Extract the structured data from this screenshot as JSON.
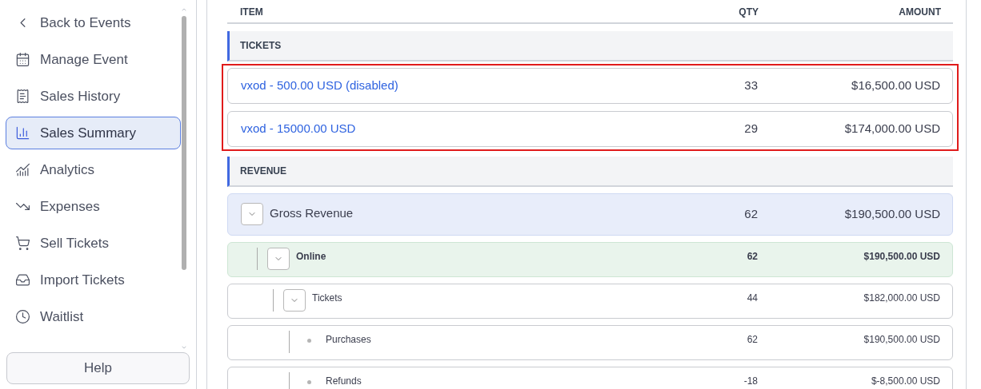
{
  "sidebar": {
    "items": [
      {
        "label": "Back to Events",
        "selected": false
      },
      {
        "label": "Manage Event",
        "selected": false
      },
      {
        "label": "Sales History",
        "selected": false
      },
      {
        "label": "Sales Summary",
        "selected": true
      },
      {
        "label": "Analytics",
        "selected": false
      },
      {
        "label": "Expenses",
        "selected": false
      },
      {
        "label": "Sell Tickets",
        "selected": false
      },
      {
        "label": "Import Tickets",
        "selected": false
      },
      {
        "label": "Waitlist",
        "selected": false
      }
    ],
    "help_button": "Help"
  },
  "table": {
    "columns": [
      "ITEM",
      "QTY",
      "AMOUNT"
    ],
    "sections": [
      {
        "kind": "tickets",
        "title": "TICKETS",
        "highlighted": true,
        "rows": [
          {
            "item": "vxod - 500.00 USD (disabled)",
            "qty": "33",
            "amount": "$16,500.00 USD"
          },
          {
            "item": "vxod - 15000.00 USD",
            "qty": "29",
            "amount": "$174,000.00 USD"
          }
        ]
      },
      {
        "kind": "tree",
        "title": "REVENUE",
        "highlighted": false,
        "rows": [
          {
            "item": "Gross Revenue",
            "qty": "62",
            "amount": "$190,500.00 USD",
            "expanded": true,
            "children": [
              {
                "item": "Online",
                "qty": "62",
                "amount": "$190,500.00 USD",
                "expanded": true,
                "children": [
                  {
                    "item": "Tickets",
                    "qty": "44",
                    "amount": "$182,000.00 USD",
                    "expanded": true,
                    "children": [
                      {
                        "item": "Purchases",
                        "qty": "62",
                        "amount": "$190,500.00 USD"
                      },
                      {
                        "item": "Refunds",
                        "qty": "-18",
                        "amount": "$-8,500.00 USD"
                      }
                    ]
                  }
                ]
              }
            ]
          }
        ]
      }
    ]
  }
}
